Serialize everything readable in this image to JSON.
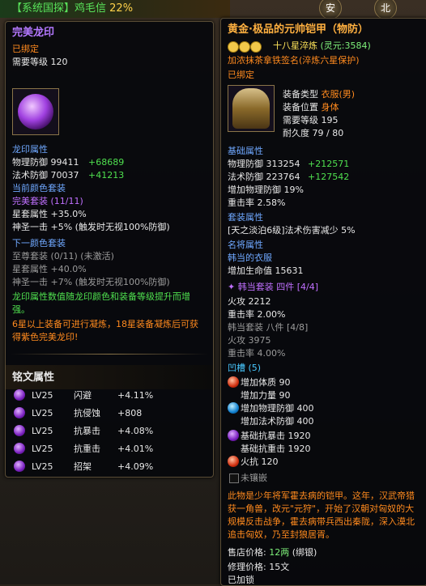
{
  "topbar": {
    "text": "【系统国探】鸡毛信",
    "pct": "22%"
  },
  "topicons": [
    "安",
    "北"
  ],
  "left": {
    "title": "完美龙印",
    "bound": "已绑定",
    "req_level": "需要等级 120",
    "section_attr": "龙印属性",
    "phys_def": "物理防御 99411",
    "phys_def_bonus": "+68689",
    "mag_def": "法术防御 70037",
    "mag_def_bonus": "+41213",
    "current_set": "当前颜色套装",
    "set_name": "完美套装 (11/11)",
    "star_attr": "星套属性 +35.0%",
    "holy_strike": "神圣一击 +5% (触发时无视100%防御)",
    "next_set": "下一颜色套装",
    "next_set_name": "至尊套装 (0/11) (未激活)",
    "next_star_attr": "星套属性 +40.0%",
    "next_holy_strike": "神圣一击 +7% (触发时无视100%防御)",
    "note_green": "龙印属性数值随龙印颜色和装备等级提升而增强。",
    "note_orange": "6星以上装备可进行凝炼，18星装备凝炼后可获得紫色完美龙印!",
    "inscription_title": "铭文属性",
    "inscriptions": [
      {
        "level": "LV25",
        "name": "闪避",
        "value": "+4.11%"
      },
      {
        "level": "LV25",
        "name": "抗侵蚀",
        "value": "+808"
      },
      {
        "level": "LV25",
        "name": "抗暴击",
        "value": "+4.08%"
      },
      {
        "level": "LV25",
        "name": "抗重击",
        "value": "+4.01%"
      },
      {
        "level": "LV25",
        "name": "招架",
        "value": "+4.09%"
      }
    ]
  },
  "right": {
    "title": "黄金·极品的元帅铠甲（物防）",
    "refine": "十八星淬炼",
    "spirit": "(灵元:3584)",
    "signature": "加浓抹茶拿铁签名(淬炼六星保护)",
    "bound": "已绑定",
    "equip_type_label": "装备类型",
    "equip_type_value": "衣服(男)",
    "equip_pos_label": "装备位置",
    "equip_pos_value": "身体",
    "req_level_label": "需要等级",
    "req_level_value": "195",
    "durability_label": "耐久度",
    "durability_value": "79 / 80",
    "base_title": "基础属性",
    "phys_def": "物理防御 313254",
    "phys_def_bonus": "+212571",
    "mag_def": "法术防御 223764",
    "mag_def_bonus": "+127542",
    "inc_phys": "增加物理防御 19%",
    "heavy_hit": "重击率  2.58%",
    "set_title": "套装属性",
    "set_line": "[天之淡泊6级]法术伤害减少 5%",
    "named_title": "名将属性",
    "named_sub": "韩当的衣服",
    "hp": "增加生命值 15631",
    "set2_name": "韩当套装 四件",
    "set2_count": "[4/4]",
    "fire_atk": "火攻 2212",
    "heavy_rate": "重击率 2.00%",
    "set3": "韩当套装 八件 [4/8]",
    "fire_atk2": "火攻 3975",
    "heavy_rate2": "重击率 4.00%",
    "slots_title": "凹槽 (5)",
    "slots": [
      {
        "text": "增加体质 90",
        "gem": "red"
      },
      {
        "text": "增加力量 90",
        "gem": ""
      },
      {
        "text": "增加物理防御 400",
        "gem": "blue"
      },
      {
        "text": "增加法术防御 400",
        "gem": ""
      },
      {
        "text": "基础抗暴击 1920",
        "gem": "purple"
      },
      {
        "text": "基础抗重击 1920",
        "gem": ""
      },
      {
        "text": "火抗 120",
        "gem": "red"
      }
    ],
    "unenchanted": "未镶嵌",
    "description": "此物是少年将军霍去病的铠甲。这年，汉武帝猎获一角兽，改元\"元狩\"，开始了汉朝对匈奴的大规模反击战争，霍去病带兵西出秦陇，深入漠北追击匈奴，乃至封狼居胥。",
    "sell_price_label": "售店价格:",
    "sell_price_value": "12两",
    "sell_price_note": "(绑银)",
    "repair_price": "修理价格: 15文",
    "locked": "已加锁"
  }
}
